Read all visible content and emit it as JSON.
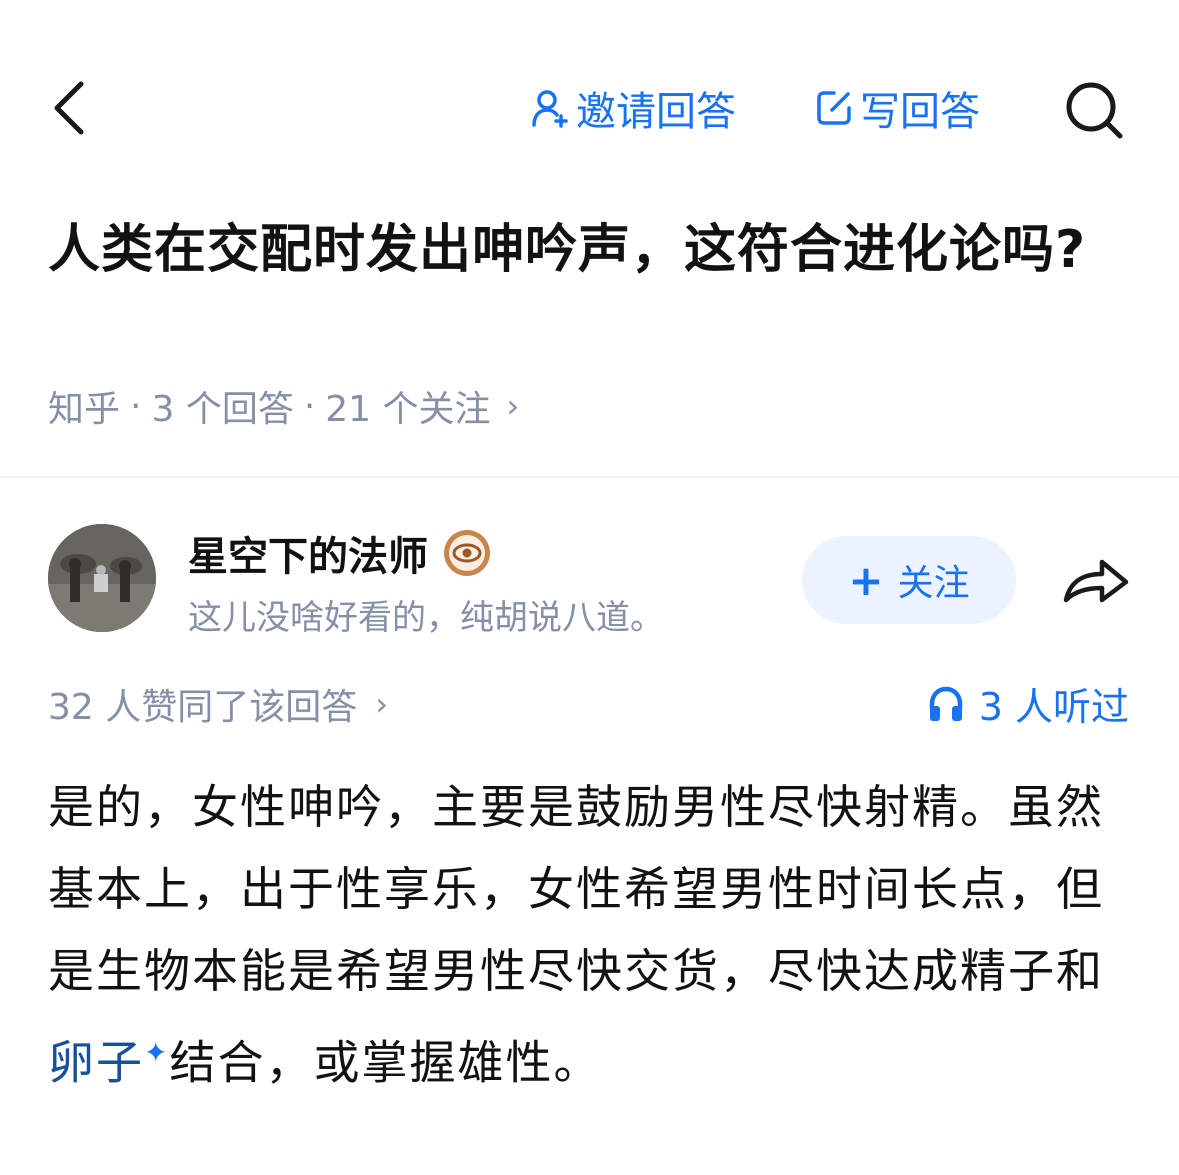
{
  "nav": {
    "invite_label": "邀请回答",
    "write_label": "写回答"
  },
  "question": {
    "title": "人类在交配时发出呻吟声，这符合进化论吗?",
    "source": "知乎",
    "answers_count": "3 个回答",
    "followers_count": "21 个关注",
    "separator": "·"
  },
  "author": {
    "name": "星空下的法师",
    "bio": "这儿没啥好看的，纯胡说八道。",
    "follow_label": "关注"
  },
  "stats": {
    "voters": "32 人赞同了该回答",
    "listened": "3 人听过"
  },
  "answer": {
    "part1": "是的，女性呻吟，主要是鼓励男性尽快射精。虽然基本上，出于性享乐，女性希望男性时间长点，但是生物本能是希望男性尽快交货，尽快达成精子和",
    "link_text": "卵子",
    "part2": "结合，或掌握雄性。"
  },
  "colors": {
    "accent": "#1772f6",
    "muted": "#8590a6",
    "link": "#175199",
    "text": "#121212"
  },
  "icons": [
    "back-chevron-icon",
    "invite-user-icon",
    "edit-icon",
    "search-icon",
    "creator-badge-icon",
    "share-arrow-icon",
    "headphones-icon",
    "sparkle-icon"
  ]
}
